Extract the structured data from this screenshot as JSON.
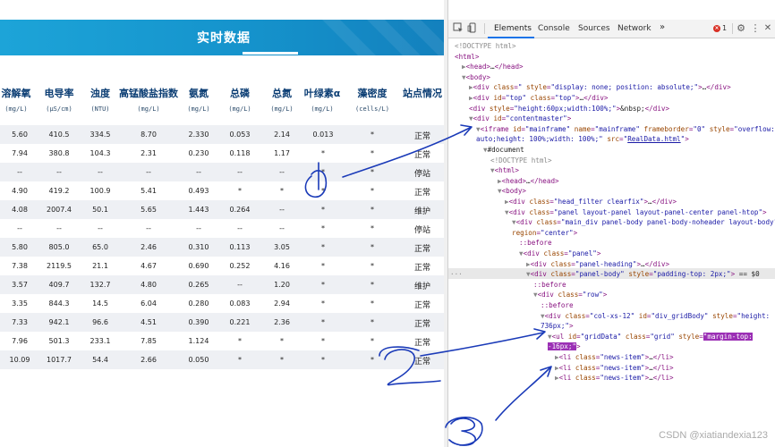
{
  "banner": {
    "title": "实时数据"
  },
  "table": {
    "headers": [
      {
        "name": "溶解氧",
        "unit": "(mg/L)"
      },
      {
        "name": "电导率",
        "unit": "(μS/cm)"
      },
      {
        "name": "浊度",
        "unit": "(NTU)"
      },
      {
        "name": "高锰酸盐指数",
        "unit": "(mg/L)"
      },
      {
        "name": "氨氮",
        "unit": "(mg/L)"
      },
      {
        "name": "总磷",
        "unit": "(mg/L)"
      },
      {
        "name": "总氮",
        "unit": "(mg/L)"
      },
      {
        "name": "叶绿素α",
        "unit": "(mg/L)"
      },
      {
        "name": "藻密度",
        "unit": "(cells/L)"
      },
      {
        "name": "站点情况",
        "unit": ""
      }
    ],
    "rows": [
      [
        "5.60",
        "410.5",
        "334.5",
        "8.70",
        "2.330",
        "0.053",
        "2.14",
        "0.013",
        "*",
        "正常"
      ],
      [
        "7.94",
        "380.8",
        "104.3",
        "2.31",
        "0.230",
        "0.118",
        "1.17",
        "*",
        "*",
        "正常"
      ],
      [
        "--",
        "--",
        "--",
        "--",
        "--",
        "--",
        "--",
        "*",
        "*",
        "停站"
      ],
      [
        "4.90",
        "419.2",
        "100.9",
        "5.41",
        "0.493",
        "*",
        "*",
        "*",
        "*",
        "正常"
      ],
      [
        "4.08",
        "2007.4",
        "50.1",
        "5.65",
        "1.443",
        "0.264",
        "--",
        "*",
        "*",
        "维护"
      ],
      [
        "--",
        "--",
        "--",
        "--",
        "--",
        "--",
        "--",
        "*",
        "*",
        "停站"
      ],
      [
        "5.80",
        "805.0",
        "65.0",
        "2.46",
        "0.310",
        "0.113",
        "3.05",
        "*",
        "*",
        "正常"
      ],
      [
        "7.38",
        "2119.5",
        "21.1",
        "4.67",
        "0.690",
        "0.252",
        "4.16",
        "*",
        "*",
        "正常"
      ],
      [
        "3.57",
        "409.7",
        "132.7",
        "4.80",
        "0.265",
        "--",
        "1.20",
        "*",
        "*",
        "维护"
      ],
      [
        "3.35",
        "844.3",
        "14.5",
        "6.04",
        "0.280",
        "0.083",
        "2.94",
        "*",
        "*",
        "正常"
      ],
      [
        "7.33",
        "942.1",
        "96.6",
        "4.51",
        "0.390",
        "0.221",
        "2.36",
        "*",
        "*",
        "正常"
      ],
      [
        "7.96",
        "501.3",
        "233.1",
        "7.85",
        "1.124",
        "*",
        "*",
        "*",
        "*",
        "正常"
      ],
      [
        "10.09",
        "1017.7",
        "54.4",
        "2.66",
        "0.050",
        "*",
        "*",
        "*",
        "*",
        "正常"
      ]
    ]
  },
  "devtools": {
    "tabs": [
      "Elements",
      "Console",
      "Sources",
      "Network"
    ],
    "more": "»",
    "error_count": "1",
    "error_badge": "×",
    "inspect_icon": "▢",
    "device_icon": "▯",
    "settings_icon": "⚙",
    "menu_icon": "⋮",
    "close_icon": "✕",
    "dom_lines": [
      {
        "indent": 0,
        "html": "<span class='g'>&lt;!DOCTYPE html&gt;</span>"
      },
      {
        "indent": 0,
        "html": "<span class='t'>&lt;html&gt;</span>"
      },
      {
        "indent": 1,
        "html": "<span class='g'>▶</span><span class='t'>&lt;head&gt;</span><span class='x'>…</span><span class='t'>&lt;/head&gt;</span>"
      },
      {
        "indent": 1,
        "html": "<span class='g'>▼</span><span class='t'>&lt;body&gt;</span>"
      },
      {
        "indent": 2,
        "html": "<span class='g'>▶</span><span class='t'>&lt;div </span><span class='a'>class</span><span class='t'>=</span><span class='v'>\"</span><span class='t'> </span><span class='a'>style</span><span class='t'>=</span><span class='v'>\"display: none; position: absolute;\"</span><span class='t'>&gt;</span><span class='x'>…</span><span class='t'>&lt;/div&gt;</span>"
      },
      {
        "indent": 2,
        "html": "<span class='g'>▶</span><span class='t'>&lt;div </span><span class='a'>id</span><span class='t'>=</span><span class='v'>\"top\"</span><span class='t'> </span><span class='a'>class</span><span class='t'>=</span><span class='v'>\"top\"</span><span class='t'>&gt;</span><span class='x'>…</span><span class='t'>&lt;/div&gt;</span>"
      },
      {
        "indent": 2,
        "html": "<span class='t'>&lt;div </span><span class='a'>style</span><span class='t'>=</span><span class='v'>\"height:60px;width:100%;\"</span><span class='t'>&gt;</span><span class='x'>&amp;nbsp;</span><span class='t'>&lt;/div&gt;</span>"
      },
      {
        "indent": 2,
        "html": "<span class='g'>▼</span><span class='t'>&lt;div </span><span class='a'>id</span><span class='t'>=</span><span class='v'>\"contentmaster\"</span><span class='t'>&gt;</span>"
      },
      {
        "indent": 3,
        "html": "<span class='g'>▼</span><span class='t'>&lt;iframe </span><span class='a'>id</span><span class='t'>=</span><span class='v'>\"mainframe\"</span><span class='t'> </span><span class='a'>name</span><span class='t'>=</span><span class='v'>\"mainframe\"</span><span class='t'> </span><span class='a'>frameborder</span><span class='t'>=</span><span class='v'>\"0\"</span><span class='t'> </span><span class='a'>style</span><span class='t'>=</span><span class='v'>\"overflow:</span>"
      },
      {
        "indent": 3,
        "html": "<span class='v'>auto;height: 100%;width: 100%;\"</span><span class='t'> </span><span class='a'>src</span><span class='t'>=</span><span class='v'>\"</span><span class='lnk'>RealData.html</span><span class='v'>\"</span><span class='t'>&gt;</span>"
      },
      {
        "indent": 4,
        "html": "<span class='g'>▼</span><span class='x'>#document</span>"
      },
      {
        "indent": 5,
        "html": "<span class='g'>&lt;!DOCTYPE html&gt;</span>"
      },
      {
        "indent": 5,
        "html": "<span class='g'>▼</span><span class='t'>&lt;html&gt;</span>"
      },
      {
        "indent": 6,
        "html": "<span class='g'>▶</span><span class='t'>&lt;head&gt;</span><span class='x'>…</span><span class='t'>&lt;/head&gt;</span>"
      },
      {
        "indent": 6,
        "html": "<span class='g'>▼</span><span class='t'>&lt;body&gt;</span>"
      },
      {
        "indent": 7,
        "html": "<span class='g'>▶</span><span class='t'>&lt;div </span><span class='a'>class</span><span class='t'>=</span><span class='v'>\"head_filter clearfix\"</span><span class='t'>&gt;</span><span class='x'>…</span><span class='t'>&lt;/div&gt;</span>"
      },
      {
        "indent": 7,
        "html": "<span class='g'>▼</span><span class='t'>&lt;div </span><span class='a'>class</span><span class='t'>=</span><span class='v'>\"panel layout-panel layout-panel-center panel-htop\"</span><span class='t'>&gt;</span>"
      },
      {
        "indent": 8,
        "html": "<span class='g'>▼</span><span class='t'>&lt;div </span><span class='a'>class</span><span class='t'>=</span><span class='v'>\"main_div panel-body panel-body-noheader layout-body\"</span>"
      },
      {
        "indent": 8,
        "html": "<span class='a'>region</span><span class='t'>=</span><span class='v'>\"center\"</span><span class='t'>&gt;</span>"
      },
      {
        "indent": 9,
        "html": "<span class='ps'>::before</span>"
      },
      {
        "indent": 9,
        "html": "<span class='g'>▼</span><span class='t'>&lt;div </span><span class='a'>class</span><span class='t'>=</span><span class='v'>\"panel\"</span><span class='t'>&gt;</span>"
      },
      {
        "indent": 10,
        "html": "<span class='g'>▶</span><span class='t'>&lt;div </span><span class='a'>class</span><span class='t'>=</span><span class='v'>\"panel-heading\"</span><span class='t'>&gt;</span><span class='x'>…</span><span class='t'>&lt;/div&gt;</span>"
      },
      {
        "indent": 10,
        "html": "<span class='g'>▼</span><span class='t'>&lt;div </span><span class='a'>class</span><span class='t'>=</span><span class='v'>\"panel-body\"</span><span class='t'> </span><span class='a'>style</span><span class='t'>=</span><span class='v'>\"padding-top: 2px;\"</span><span class='t'>&gt;</span><span class='x'> == $0</span>",
        "selected": true
      },
      {
        "indent": 11,
        "html": "<span class='ps'>::before</span>"
      },
      {
        "indent": 11,
        "html": "<span class='g'>▼</span><span class='t'>&lt;div </span><span class='a'>class</span><span class='t'>=</span><span class='v'>\"row\"</span><span class='t'>&gt;</span>"
      },
      {
        "indent": 12,
        "html": "<span class='ps'>::before</span>"
      },
      {
        "indent": 12,
        "html": "<span class='g'>▼</span><span class='t'>&lt;div </span><span class='a'>class</span><span class='t'>=</span><span class='v'>\"col-xs-12\"</span><span class='t'> </span><span class='a'>id</span><span class='t'>=</span><span class='v'>\"div_gridBody\"</span><span class='t'> </span><span class='a'>style</span><span class='t'>=</span><span class='v'>\"height:</span>"
      },
      {
        "indent": 12,
        "html": "<span class='v'>736px;\"</span><span class='t'>&gt;</span>"
      },
      {
        "indent": 13,
        "html": "<span class='g'>▼</span><span class='t'>&lt;ul </span><span class='a'>id</span><span class='t'>=</span><span class='v'>\"gridData\"</span><span class='t'> </span><span class='a'>class</span><span class='t'>=</span><span class='v'>\"grid\"</span><span class='t'> </span><span class='a'>style</span><span class='t'>=</span><span class='hl'>\"margin-top:</span>"
      },
      {
        "indent": 13,
        "html": "<span class='hl'>-16px;\"</span><span class='t'>&gt;</span>"
      },
      {
        "indent": 14,
        "html": "<span class='g'>▶</span><span class='t'>&lt;li </span><span class='a'>class</span><span class='t'>=</span><span class='v'>\"news-item\"</span><span class='t'>&gt;</span><span class='x'>…</span><span class='t'>&lt;/li&gt;</span>"
      },
      {
        "indent": 14,
        "html": "<span class='g'>▶</span><span class='t'>&lt;li </span><span class='a'>class</span><span class='t'>=</span><span class='v'>\"news-item\"</span><span class='t'>&gt;</span><span class='x'>…</span><span class='t'>&lt;/li&gt;</span>"
      },
      {
        "indent": 14,
        "html": "<span class='g'>▶</span><span class='t'>&lt;li </span><span class='a'>class</span><span class='t'>=</span><span class='v'>\"news-item\"</span><span class='t'>&gt;</span><span class='x'>…</span><span class='t'>&lt;/li&gt;</span>"
      }
    ]
  },
  "watermark": "CSDN @xiatiandexia123",
  "colors": {
    "banner": "#1593cc",
    "accent": "#1a73e8",
    "annotation": "#1a3ab8",
    "highlight": "#9b2fb5"
  }
}
